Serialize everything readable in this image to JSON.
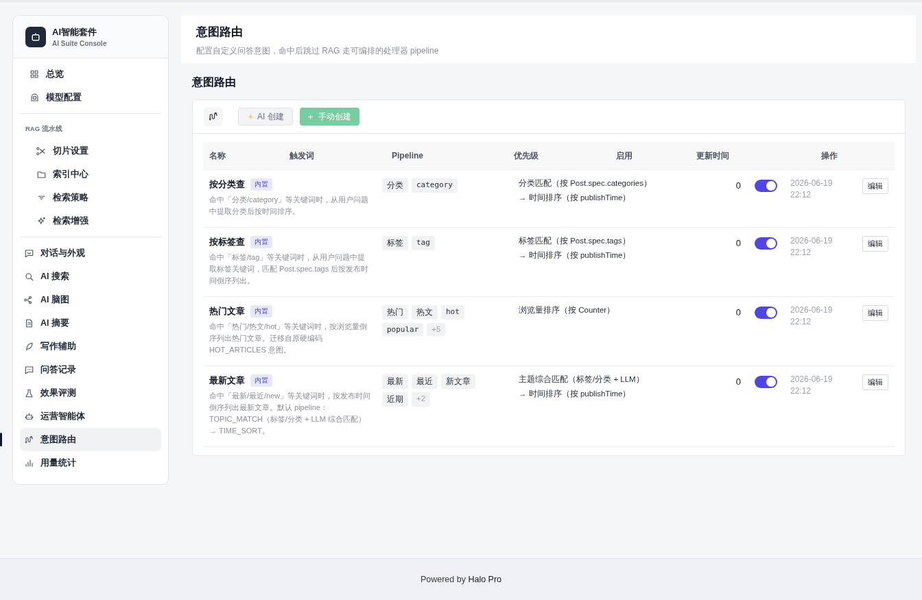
{
  "sidebar": {
    "brand": {
      "title": "AI智能套件",
      "subtitle": "AI Suite Console"
    },
    "groups": [
      {
        "items": [
          {
            "label": "总览",
            "selected": false
          },
          {
            "label": "模型配置",
            "selected": false
          }
        ]
      },
      {
        "heading": "RAG 流水线",
        "items": [
          {
            "label": "切片设置",
            "selected": false
          },
          {
            "label": "索引中心",
            "selected": false
          },
          {
            "label": "检索策略",
            "selected": false
          },
          {
            "label": "检索增强",
            "selected": false
          }
        ]
      },
      {
        "items": [
          {
            "label": "对话与外观",
            "selected": false
          },
          {
            "label": "AI 搜索",
            "selected": false
          },
          {
            "label": "AI 脑图",
            "selected": false
          },
          {
            "label": "AI 摘要",
            "selected": false
          },
          {
            "label": "写作辅助",
            "selected": false
          },
          {
            "label": "问答记录",
            "selected": false
          },
          {
            "label": "效果评测",
            "selected": false
          },
          {
            "label": "运营智能体",
            "selected": false
          },
          {
            "label": "意图路由",
            "selected": true
          },
          {
            "label": "用量统计",
            "selected": false
          }
        ]
      }
    ]
  },
  "header": {
    "title": "意图路由",
    "subtitle": "配置自定义问答意图，命中后跳过 RAG 走可编排的处理器 pipeline"
  },
  "section_title": "意图路由",
  "toolbar": {
    "buttons": [
      {
        "label": "AI 创建",
        "kind": "ai"
      },
      {
        "label": "手动创建",
        "kind": "manual",
        "icon_text": "+"
      }
    ]
  },
  "table": {
    "columns": [
      "名称",
      "触发词",
      "Pipeline",
      "优先级",
      "启用",
      "更新时间",
      "操作"
    ],
    "rows": [
      {
        "name": "按分类查",
        "badge": "内置",
        "description": "命中「分类/category」等关键词时，从用户问题中提取分类后按时间排序。",
        "triggers": [
          {
            "text": "分类",
            "kind": "word"
          },
          {
            "text": "category",
            "kind": "code"
          }
        ],
        "pipeline": [
          "分类匹配（按 Post.spec.categories）",
          "→ 时间排序（按 publishTime）"
        ],
        "priority": "0",
        "enabled": true,
        "updated": [
          "2026-06-19",
          "22:12"
        ],
        "action": "编辑"
      },
      {
        "name": "按标签查",
        "badge": "内置",
        "description": "命中「标签/tag」等关键词时，从用户问题中提取标签关键词，匹配 Post.spec.tags 后按发布时间倒序列出。",
        "triggers": [
          {
            "text": "标签",
            "kind": "word"
          },
          {
            "text": "tag",
            "kind": "code"
          }
        ],
        "pipeline": [
          "标签匹配（按 Post.spec.tags）",
          "→ 时间排序（按 publishTime）"
        ],
        "priority": "0",
        "enabled": true,
        "updated": [
          "2026-06-19",
          "22:12"
        ],
        "action": "编辑"
      },
      {
        "name": "热门文章",
        "badge": "内置",
        "description": "命中「热门/热文/hot」等关键词时，按浏览量倒序列出热门文章。迁移自原硬编码 HOT_ARTICLES 意图。",
        "triggers": [
          {
            "text": "热门",
            "kind": "word"
          },
          {
            "text": "热文",
            "kind": "word"
          },
          {
            "text": "hot",
            "kind": "code"
          },
          {
            "text": "popular",
            "kind": "code"
          },
          {
            "text": "+5",
            "kind": "more"
          }
        ],
        "pipeline": [
          "浏览量排序（按 Counter）"
        ],
        "priority": "0",
        "enabled": true,
        "updated": [
          "2026-06-19",
          "22:12"
        ],
        "action": "编辑"
      },
      {
        "name": "最新文章",
        "badge": "内置",
        "description": "命中「最新/最近/new」等关键词时，按发布时间倒序列出最新文章。默认 pipeline：TOPIC_MATCH（标签/分类 + LLM 综合匹配）→ TIME_SORT。",
        "triggers": [
          {
            "text": "最新",
            "kind": "word"
          },
          {
            "text": "最近",
            "kind": "word"
          },
          {
            "text": "新文章",
            "kind": "word"
          },
          {
            "text": "近期",
            "kind": "word"
          },
          {
            "text": "+2",
            "kind": "more"
          }
        ],
        "pipeline": [
          "主题综合匹配（标签/分类 + LLM）",
          "→ 时间排序（按 publishTime）"
        ],
        "priority": "0",
        "enabled": true,
        "updated": [
          "2026-06-19",
          "22:12"
        ],
        "action": "编辑"
      }
    ]
  },
  "footer": {
    "text": "Powered by",
    "brand": "Halo Pro"
  }
}
